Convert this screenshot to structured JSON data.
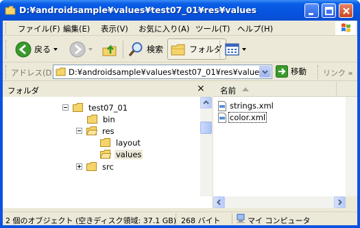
{
  "window": {
    "title": "D:¥androidsample¥values¥test07_01¥res¥values"
  },
  "menu": {
    "items": [
      "ファイル(F)",
      "編集(E)",
      "表示(V)",
      "お気に入り(A)",
      "ツール(T)",
      "ヘルプ(H)"
    ]
  },
  "toolbar": {
    "back_label": "戻る",
    "search_label": "検索",
    "folders_label": "フォルダ"
  },
  "address": {
    "label": "アドレス(D)",
    "path": "D:¥androidsample¥values¥test07_01¥res¥values",
    "go_label": "移動",
    "links_label": "リンク"
  },
  "folder_pane": {
    "title": "フォルダ",
    "close_glyph": "×",
    "tree": [
      {
        "label": "test07_01",
        "level": 0,
        "expander": "minus"
      },
      {
        "label": "bin",
        "level": 1,
        "expander": "none"
      },
      {
        "label": "res",
        "level": 1,
        "expander": "minus"
      },
      {
        "label": "layout",
        "level": 2,
        "expander": "none"
      },
      {
        "label": "values",
        "level": 2,
        "expander": "none",
        "selected": true
      },
      {
        "label": "src",
        "level": 1,
        "expander": "plus"
      }
    ]
  },
  "file_list": {
    "column_name": "名前",
    "files": [
      {
        "name": "strings.xml"
      },
      {
        "name": "color.xml",
        "focused": true
      }
    ]
  },
  "status": {
    "objects": "2 個のオブジェクト (空きディスク領域: 37.1 GB)",
    "size": "268 バイト",
    "location": "マイ コンピュータ"
  },
  "colors": {
    "titlebar": "#0553e0",
    "chrome": "#ece9d8",
    "folder": "#f5d46a"
  }
}
